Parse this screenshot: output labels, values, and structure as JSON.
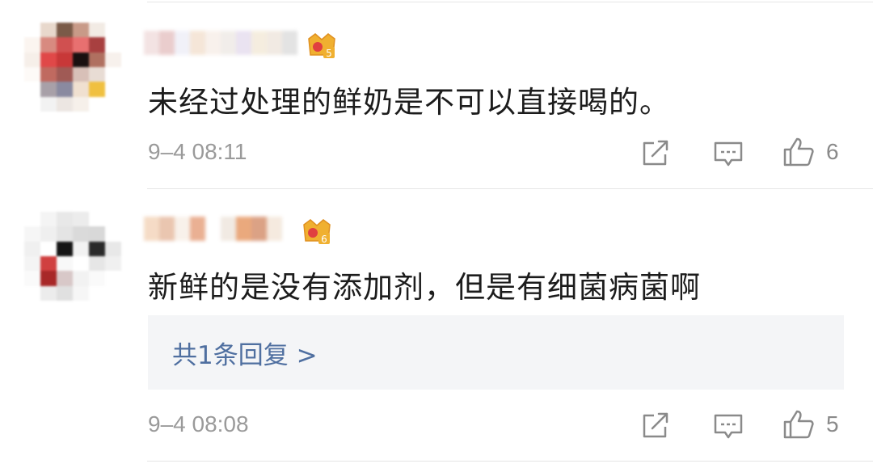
{
  "comments": [
    {
      "text": "未经过处理的鲜奶是不可以直接喝的。",
      "time": "9–4 08:11",
      "likes": "6",
      "badge_level": "5",
      "avatar_colors": [
        "#ffffff",
        "#e8d8cc",
        "#7a5a48",
        "#c89a88",
        "#f2ebe4",
        "#ffffff",
        "#fbf5f0",
        "#d88a80",
        "#d05050",
        "#e87070",
        "#a84040",
        "#ffffff",
        "#f6efe9",
        "#e04848",
        "#c83838",
        "#1a1010",
        "#b07060",
        "#f7f1ec",
        "#fdfaf7",
        "#c06a60",
        "#a05a55",
        "#d8c0b8",
        "#e8dcd4",
        "#ffffff",
        "#ffffff",
        "#a8a0a8",
        "#8a8aa0",
        "#f0e0d0",
        "#f0c040",
        "#ffffff",
        "#ffffff",
        "#f2f2f2",
        "#ece6e2",
        "#f6f0ea",
        "#ffffff",
        "#ffffff"
      ],
      "name_colors": [
        "#f2e0e0",
        "#e8c8c8",
        "#f0f0f8",
        "#f4e4d4",
        "#f8f0ea",
        "#f0ece8",
        "#e8e0f0",
        "#f4ecdc",
        "#f0e8e0",
        "#e0e0e0"
      ]
    },
    {
      "text": "新鲜的是没有添加剂，但是有细菌病菌啊",
      "time": "9–4 08:08",
      "likes": "5",
      "badge_level": "6",
      "reply_link": "共1条回复 >",
      "avatar_colors": [
        "#ffffff",
        "#f4f4f4",
        "#e8e8e8",
        "#ececec",
        "#ffffff",
        "#ffffff",
        "#f6f6f6",
        "#efefef",
        "#e4e4e4",
        "#dadada",
        "#d8d8d8",
        "#ffffff",
        "#f0f0f0",
        "#ffffff",
        "#151515",
        "#f2f2f2",
        "#2a2a2a",
        "#e8e8e8",
        "#f4f4f4",
        "#d04040",
        "#f8f8f8",
        "#ffffff",
        "#e6e6e6",
        "#f0f0f0",
        "#fafafa",
        "#a82828",
        "#d8c8c8",
        "#f2f2f2",
        "#fafafa",
        "#ffffff",
        "#ffffff",
        "#ececec",
        "#e0e0e0",
        "#f6f6f6",
        "#ffffff",
        "#ffffff"
      ],
      "name_colors": [
        "#f4d8c0",
        "#e8c0a8",
        "#f8f0e8",
        "#e8a888",
        "#ffffff",
        "#f0e8e0",
        "#e8a070",
        "#d89878",
        "#f4e8dc",
        "#ffffff"
      ]
    }
  ],
  "colors": {
    "link": "#4f6fa0",
    "badge_gold": "#f0b030",
    "badge_red": "#e04040"
  }
}
